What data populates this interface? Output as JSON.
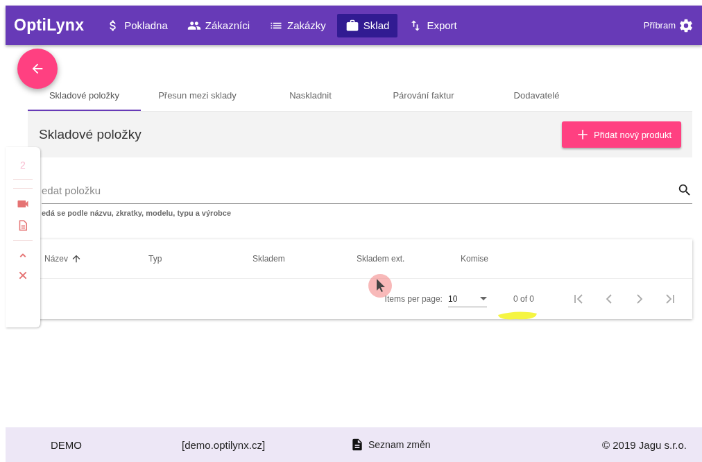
{
  "header": {
    "logo": "OptiLynx",
    "nav": [
      {
        "label": "Pokladna",
        "selected": false
      },
      {
        "label": "Zákazníci",
        "selected": false
      },
      {
        "label": "Zakázky",
        "selected": false
      },
      {
        "label": "Sklad",
        "selected": true
      },
      {
        "label": "Export",
        "selected": false
      }
    ],
    "location": "Příbram"
  },
  "tabs": [
    {
      "label": "Skladové položky",
      "selected": true
    },
    {
      "label": "Přesun mezi sklady",
      "selected": false
    },
    {
      "label": "Naskladnit",
      "selected": false
    },
    {
      "label": "Párování faktur",
      "selected": false
    },
    {
      "label": "Dodavatelé",
      "selected": false
    }
  ],
  "toolbar": {
    "title": "Skladové položky",
    "add_button": "Přidat nový produkt"
  },
  "search": {
    "placeholder": "edat položku",
    "hint": "edá se podle názvu, zkratky, modelu, typu a výrobce"
  },
  "table": {
    "columns": [
      {
        "label": "Název",
        "sorted": true
      },
      {
        "label": "Typ",
        "sorted": false
      },
      {
        "label": "Skladem",
        "sorted": false
      },
      {
        "label": "Skladem ext.",
        "sorted": false
      },
      {
        "label": "Komise",
        "sorted": false
      }
    ],
    "paginator": {
      "items_per_page_label": "Items per page:",
      "page_size": "10",
      "range": "0 of 0"
    }
  },
  "side_toolbar": {
    "count": "2"
  },
  "footer": {
    "mode": "DEMO",
    "domain": "[demo.optilynx.cz]",
    "changelog": "Seznam změn",
    "copyright": "© 2019 Jagu s.r.o."
  }
}
